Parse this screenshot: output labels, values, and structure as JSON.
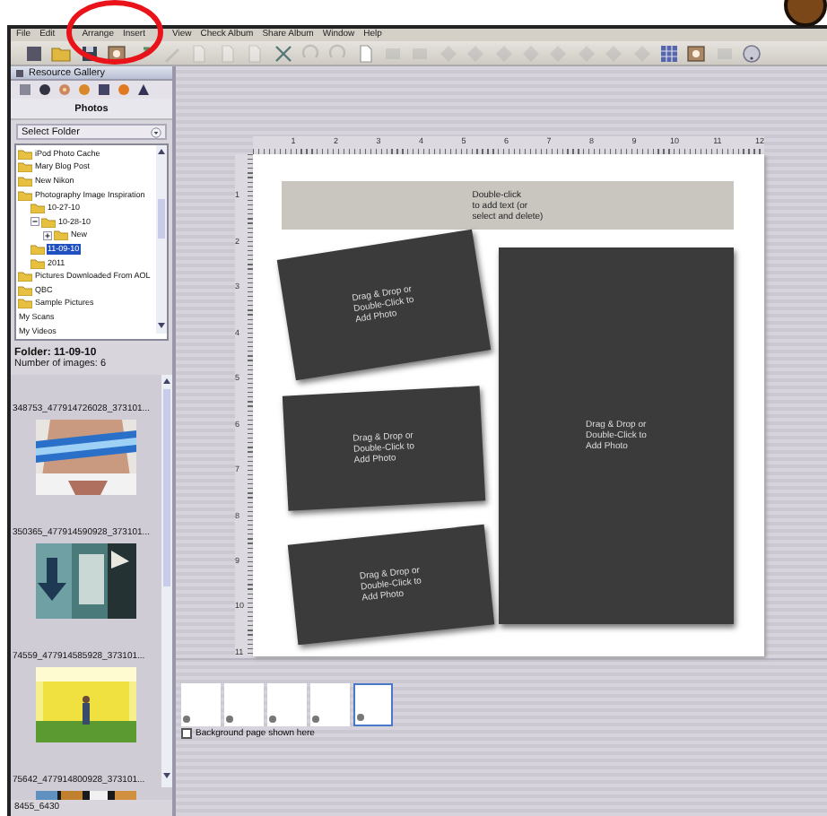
{
  "menu": [
    "File",
    "Edit",
    "Arrange",
    "Insert",
    "View",
    "Check Album",
    "Share Album",
    "Window",
    "Help"
  ],
  "toolbar": [
    {
      "disabled": false
    },
    {
      "disabled": false
    },
    {
      "disabled": false
    },
    {
      "disabled": false
    },
    {
      "disabled": false
    },
    {
      "disabled": true
    },
    {
      "disabled": true
    },
    {
      "disabled": true
    },
    {
      "disabled": true
    },
    {
      "disabled": false
    },
    {
      "disabled": true
    },
    {
      "disabled": true
    },
    {
      "disabled": false
    },
    {
      "disabled": true
    },
    {
      "disabled": true
    },
    {
      "disabled": true
    },
    {
      "disabled": true
    },
    {
      "disabled": true
    },
    {
      "disabled": true
    },
    {
      "disabled": true
    },
    {
      "disabled": true
    },
    {
      "disabled": true
    },
    {
      "disabled": true
    },
    {
      "disabled": false
    },
    {
      "disabled": false
    },
    {
      "disabled": true
    },
    {
      "disabled": false
    }
  ],
  "gallery": {
    "title": "Resource Gallery",
    "tab": "Photos",
    "folder_picker": "Select Folder",
    "tree": [
      {
        "label": "iPod Photo Cache",
        "kind": "folder",
        "selected": false
      },
      {
        "label": "Mary Blog Post",
        "kind": "folder",
        "selected": false
      },
      {
        "label": "New Nikon",
        "kind": "folder",
        "selected": false
      },
      {
        "label": "Photography Image Inspiration",
        "kind": "folder",
        "selected": false,
        "children": [
          {
            "label": "10-27-10",
            "kind": "folder",
            "selected": false
          },
          {
            "label": "10-28-10",
            "kind": "folder",
            "selected": false,
            "expanded": true,
            "children": [
              {
                "label": "New",
                "kind": "folder",
                "selected": false,
                "expanded": false
              }
            ]
          },
          {
            "label": "11-09-10",
            "kind": "folder",
            "selected": true
          },
          {
            "label": "2011",
            "kind": "folder",
            "selected": false
          }
        ]
      },
      {
        "label": "Pictures Downloaded From AOL",
        "kind": "folder",
        "selected": false
      },
      {
        "label": "QBC",
        "kind": "folder",
        "selected": false
      },
      {
        "label": "Sample Pictures",
        "kind": "folder",
        "selected": false
      },
      {
        "label": "My Scans",
        "kind": "plain",
        "selected": false
      },
      {
        "label": "My Videos",
        "kind": "plain",
        "selected": false
      }
    ],
    "folder": "Folder: 11-09-10",
    "image_count": "Number of images: 6",
    "photos": [
      {
        "caption": "348753_477914726028_373101...",
        "kind": "picture"
      },
      {
        "caption": "350365_477914590928_373101...",
        "kind": "picture"
      },
      {
        "caption": "74559_477914585928_373101...",
        "kind": "picture"
      },
      {
        "caption": "75642_477914800928_373101...",
        "kind": "picture"
      }
    ],
    "footer": "8455_6430"
  },
  "ruler": {
    "horizontal": [
      "1",
      "2",
      "3",
      "4",
      "5",
      "6",
      "7",
      "8",
      "9",
      "10",
      "11",
      "12"
    ],
    "vertical": [
      "1",
      "2",
      "3",
      "4",
      "5",
      "6",
      "7",
      "8",
      "9",
      "10",
      "11"
    ]
  },
  "page": {
    "text_box": "Double-click\nto add text (or\nselect and delete)",
    "photo_slots": [
      "Drag & Drop or\nDouble-Click to\nAdd Photo",
      "Drag & Drop or\nDouble-Click to\nAdd Photo",
      "Drag & Drop or\nDouble-Click to\nAdd Photo",
      "Drag & Drop or\nDouble-Click to\nAdd Photo"
    ]
  },
  "filmstrip": {
    "pages": [
      {
        "selected": false
      },
      {
        "selected": false
      },
      {
        "selected": false
      },
      {
        "selected": false
      },
      {
        "selected": true
      }
    ]
  },
  "background_checkbox": {
    "label": "Background page shown here",
    "checked": false
  }
}
